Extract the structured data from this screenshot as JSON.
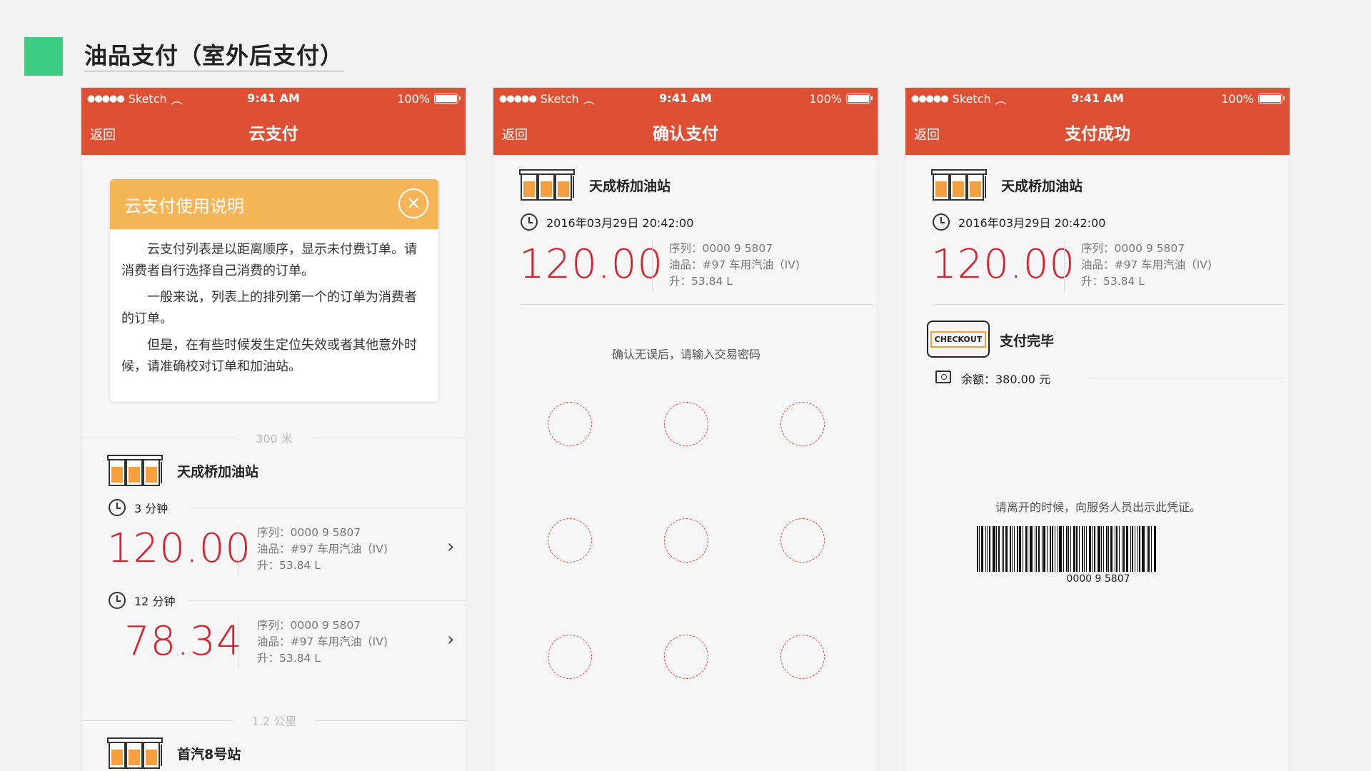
{
  "page": {
    "title": "油品支付（室外后支付）",
    "accent": "#3ecc84",
    "bar_color": "#de5034"
  },
  "status": {
    "carrier": "Sketch",
    "time": "9:41 AM",
    "battery": "100%"
  },
  "nav": {
    "back": "返回"
  },
  "screen1": {
    "title": "云支付",
    "notice": {
      "title": "云支付使用说明",
      "paragraphs": [
        "云支付列表是以距离顺序，显示未付费订单。请消费者自行选择自己消费的订单。",
        "一般来说，列表上的排列第一个的订单为消费者的订单。",
        "但是，在有些时候发生定位失效或者其他意外时候，请准确校对订单和加油站。"
      ]
    },
    "groups": [
      {
        "distance": "300 米",
        "station": "天成桥加油站",
        "orders": [
          {
            "time": "3 分钟",
            "amount": "120.00",
            "serial": "序列：0000 9 5807",
            "oil": "油品：#97 车用汽油（IV)",
            "liters": "升：53.84 L"
          },
          {
            "time": "12 分钟",
            "amount": "78.34",
            "serial": "序列：0000 9 5807",
            "oil": "油品：#97 车用汽油（IV)",
            "liters": "升：53.84 L"
          }
        ]
      },
      {
        "distance": "1.2 公里",
        "station": "首汽8号站"
      }
    ]
  },
  "screen2": {
    "title": "确认支付",
    "station": "天成桥加油站",
    "datetime": "2016年03月29日 20:42:00",
    "amount": "120.00",
    "serial": "序列：0000 9 5807",
    "oil": "油品：#97 车用汽油（IV)",
    "liters": "升：53.84 L",
    "hint": "确认无误后，请输入交易密码"
  },
  "screen3": {
    "title": "支付成功",
    "station": "天成桥加油站",
    "datetime": "2016年03月29日 20:42:00",
    "amount": "120.00",
    "serial": "序列：0000 9 5807",
    "oil": "油品：#97 车用汽油（IV)",
    "liters": "升：53.84 L",
    "checkout_label": "CHECKOUT",
    "done": "支付完毕",
    "balance": "余额：380.00 元",
    "leave_hint": "请离开的时候，向服务人员出示此凭证。",
    "barcode": "0000 9 5807"
  }
}
